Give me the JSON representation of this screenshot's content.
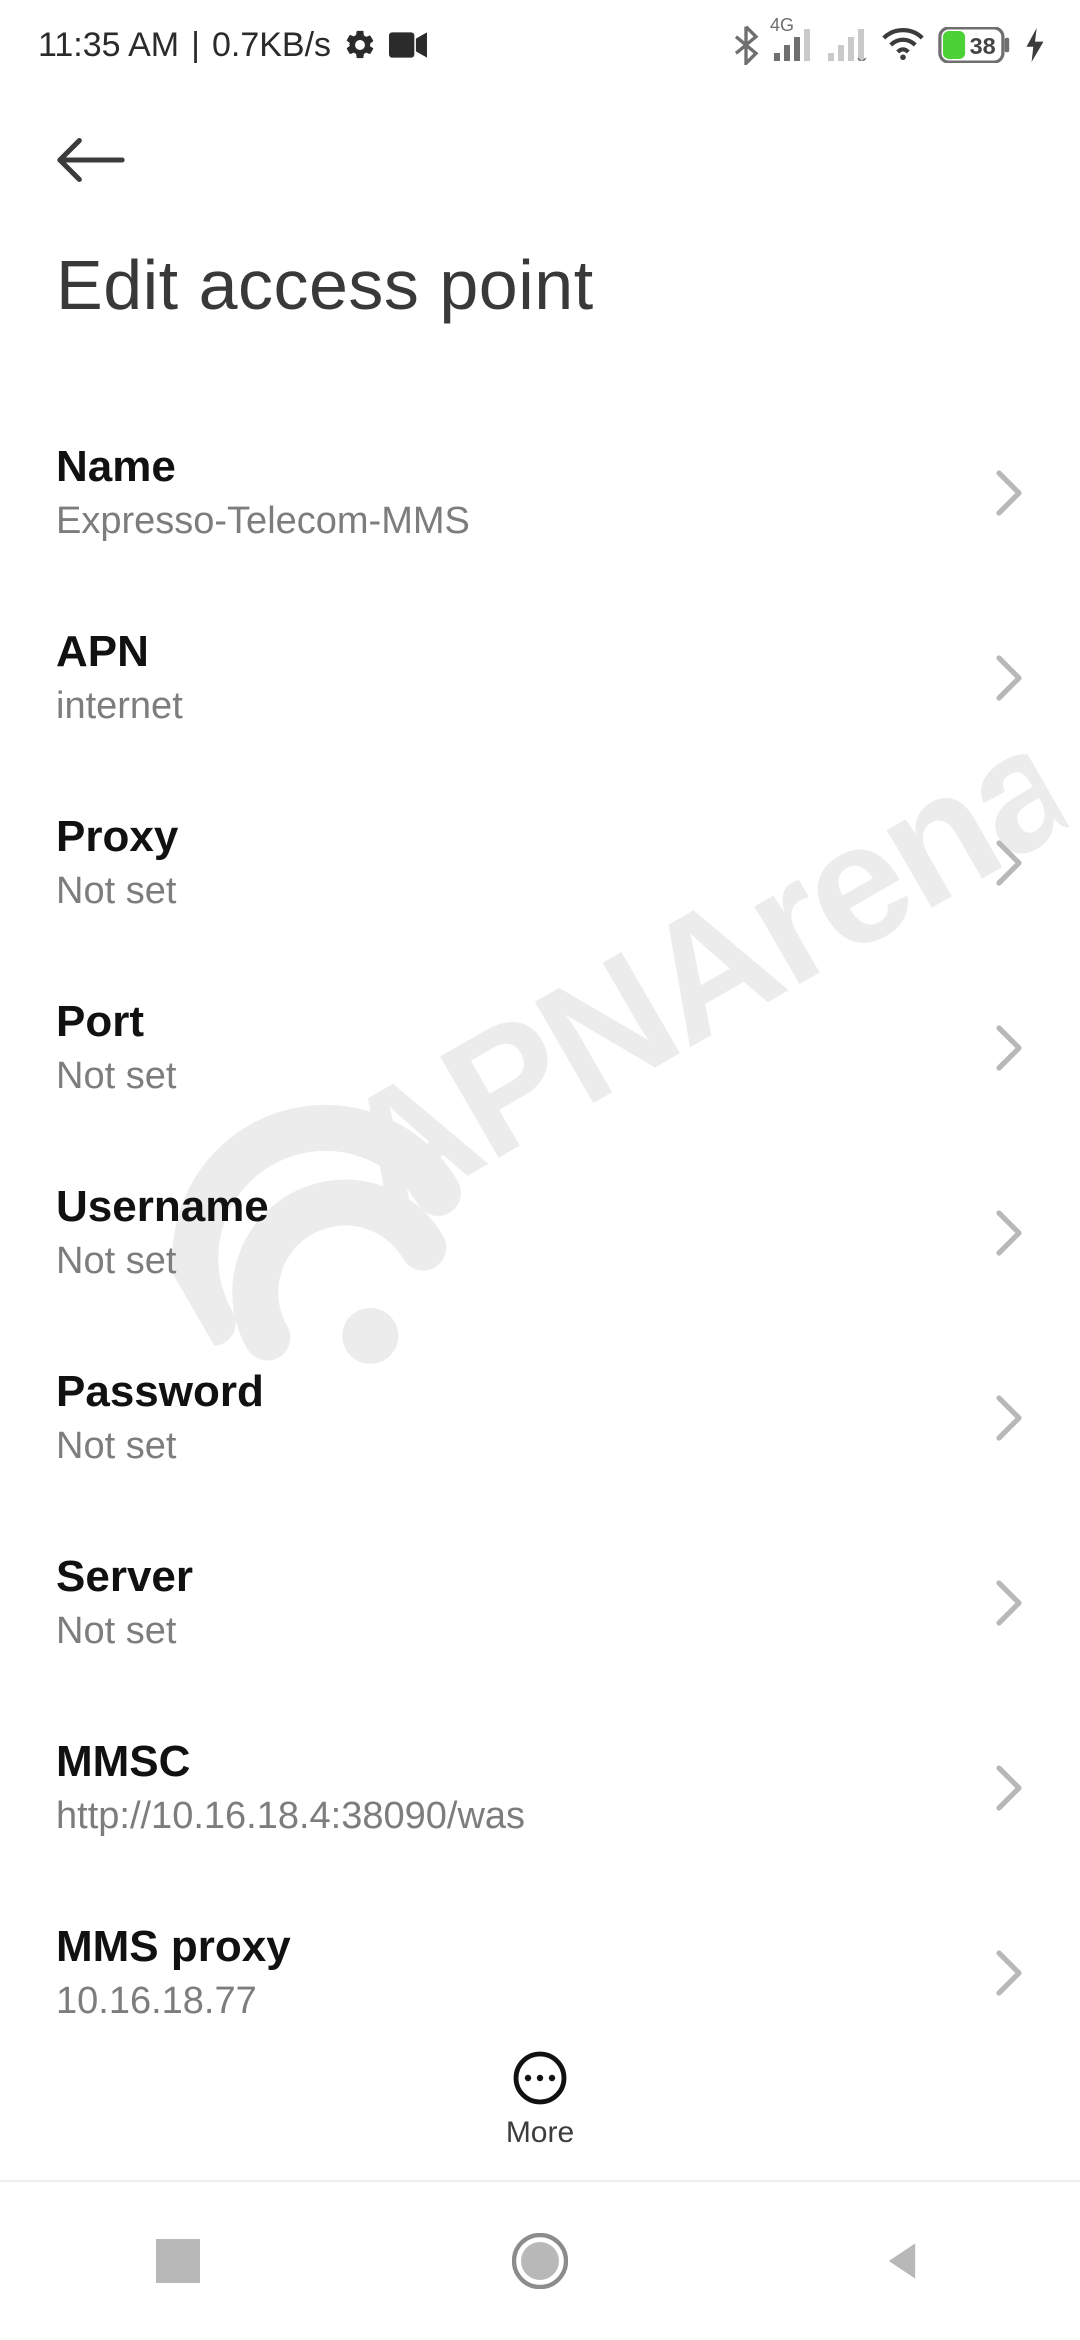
{
  "status": {
    "time": "11:35 AM",
    "sep": "|",
    "net_speed": "0.7KB/s",
    "battery_level": "38",
    "signal_label": "4G"
  },
  "page": {
    "title": "Edit access point"
  },
  "fields": [
    {
      "label": "Name",
      "value": "Expresso-Telecom-MMS"
    },
    {
      "label": "APN",
      "value": "internet"
    },
    {
      "label": "Proxy",
      "value": "Not set"
    },
    {
      "label": "Port",
      "value": "Not set"
    },
    {
      "label": "Username",
      "value": "Not set"
    },
    {
      "label": "Password",
      "value": "Not set"
    },
    {
      "label": "Server",
      "value": "Not set"
    },
    {
      "label": "MMSC",
      "value": "http://10.16.18.4:38090/was"
    },
    {
      "label": "MMS proxy",
      "value": "10.16.18.77"
    }
  ],
  "more_label": "More",
  "watermark_text": "APNArena"
}
